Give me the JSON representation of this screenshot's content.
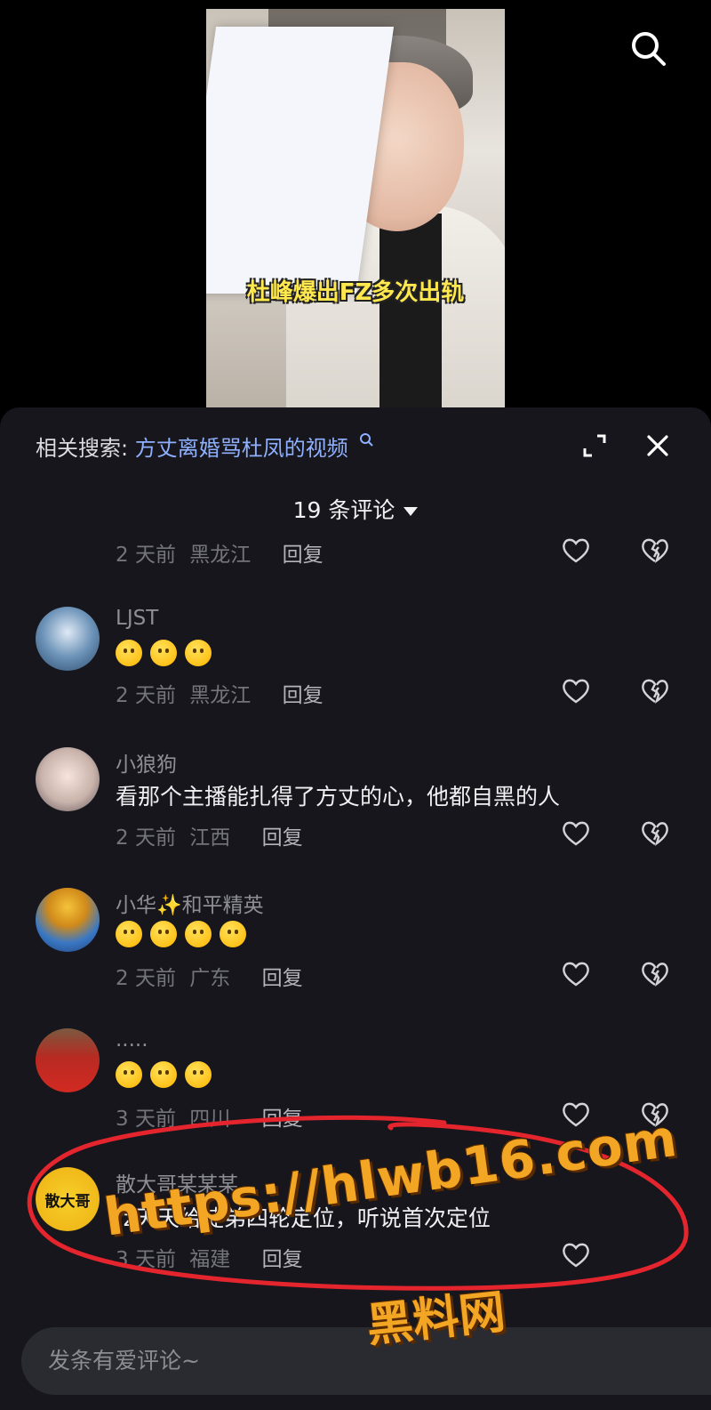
{
  "video": {
    "caption": "杜峰爆出FZ多次出轨",
    "search_icon": "search-icon"
  },
  "panel": {
    "related_label": "相关搜索:",
    "related_query": "方丈离婚骂杜凤的视频",
    "comment_count": "19 条评论",
    "icons": [
      "expand-icon",
      "close-icon",
      "chevron-down-icon"
    ]
  },
  "comments": [
    {
      "meta_time": "2 天前",
      "meta_place": "黑龙江",
      "reply": "回复"
    },
    {
      "user": "LJST",
      "emoji_count": 3,
      "meta_time": "2 天前",
      "meta_place": "黑龙江",
      "reply": "回复"
    },
    {
      "user": "小狼狗",
      "text": "看那个主播能扎得了方丈的心，他都自黑的人",
      "meta_time": "2 天前",
      "meta_place": "江西",
      "reply": "回复"
    },
    {
      "user": "小华✨和平精英",
      "emoji_count": 4,
      "meta_time": "2 天前",
      "meta_place": "广东",
      "reply": "回复"
    },
    {
      "user": ".....",
      "emoji_count": 3,
      "meta_time": "3 天前",
      "meta_place": "四川",
      "reply": "回复"
    },
    {
      "user": "散大哥某某某",
      "avatar_text": "散大哥",
      "text": "fz天天给徒弟四轮定位，听说首次定位",
      "meta_time": "3 天前",
      "meta_place": "福建",
      "reply": "回复"
    }
  ],
  "input": {
    "placeholder": "发条有爱评论~"
  },
  "watermark": {
    "line1": "https://hlwb16.com",
    "line2": "黑料网"
  },
  "colors": {
    "panel_bg": "#16161c",
    "link": "#8fb0ff",
    "caption": "#ffe84d",
    "watermark": "#f3a623",
    "ring": "#e5252d"
  }
}
